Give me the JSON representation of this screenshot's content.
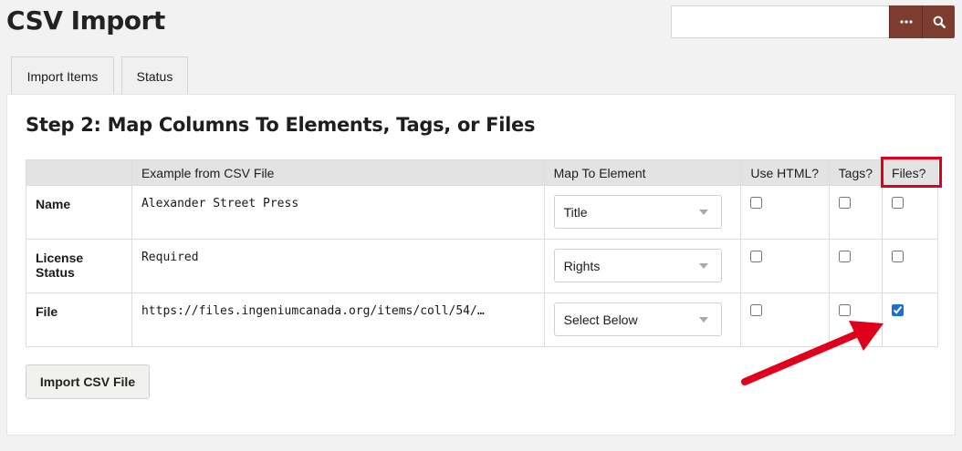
{
  "page": {
    "title": "CSV Import"
  },
  "search": {
    "placeholder": "",
    "value": ""
  },
  "header": {
    "options_icon": "ellipsis-icon",
    "search_icon": "search-icon",
    "button_color": "#7c3c30"
  },
  "tabs": [
    {
      "label": "Import Items"
    },
    {
      "label": "Status"
    }
  ],
  "step": {
    "title": "Step 2: Map Columns To Elements, Tags, or Files"
  },
  "table": {
    "headers": [
      "",
      "Example from CSV File",
      "Map To Element",
      "Use HTML?",
      "Tags?",
      "Files?"
    ],
    "rows": [
      {
        "name": "Name",
        "example": "Alexander Street Press",
        "element": "Title",
        "use_html": false,
        "tags": false,
        "files": false
      },
      {
        "name": "License Status",
        "example": "Required",
        "element": "Rights",
        "use_html": false,
        "tags": false,
        "files": false
      },
      {
        "name": "File",
        "example": "https://files.ingeniumcanada.org/items/coll/54/…",
        "element": "Select Below",
        "use_html": false,
        "tags": false,
        "files": true
      }
    ]
  },
  "actions": {
    "import_label": "Import CSV File"
  },
  "annotation": {
    "color": "#e0001b",
    "highlight": "Files?"
  }
}
